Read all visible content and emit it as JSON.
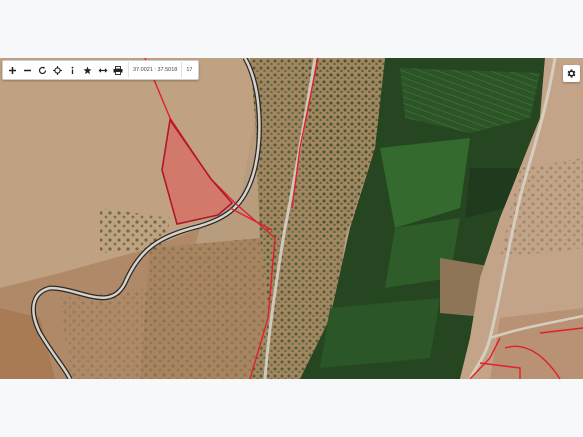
{
  "toolbar": {
    "buttons": [
      {
        "name": "zoom-in",
        "icon": "plus-icon"
      },
      {
        "name": "zoom-out",
        "icon": "minus-icon"
      },
      {
        "name": "refresh",
        "icon": "refresh-icon"
      },
      {
        "name": "locate",
        "icon": "crosshair-icon"
      },
      {
        "name": "info",
        "icon": "info-icon"
      },
      {
        "name": "favorite",
        "icon": "star-icon"
      },
      {
        "name": "measure",
        "icon": "arrows-horizontal-icon"
      },
      {
        "name": "print",
        "icon": "printer-icon"
      }
    ],
    "coordinates": "37.0021 : 37.5018",
    "zoom": "17"
  },
  "settings": {
    "icon": "gear-icon"
  },
  "map": {
    "type": "satellite",
    "parcel_fill": "#e0585a",
    "parcel_border": "#b0182a",
    "boundary_color": "#e0202c",
    "road_color": "#2a2a2a",
    "field_color": "#2f5a2a"
  }
}
